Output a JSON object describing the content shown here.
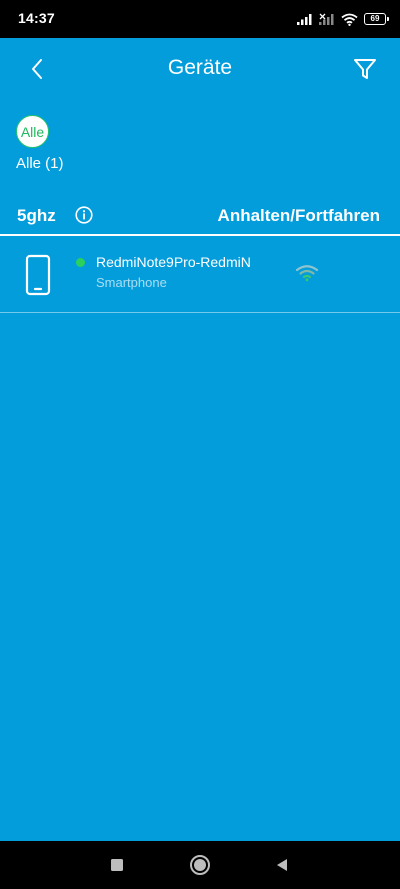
{
  "status_bar": {
    "time": "14:37",
    "battery": "69",
    "icons": [
      "signal-icon",
      "signal-no-service-icon",
      "wifi-icon",
      "battery-icon"
    ]
  },
  "header": {
    "title": "Geräte",
    "back_icon": "chevron-left-icon",
    "filter_icon": "filter-funnel-icon"
  },
  "filter": {
    "chip_label": "Alle",
    "count_label": "Alle (1)"
  },
  "band": {
    "label": "5ghz",
    "info_icon": "info-icon",
    "action_label": "Anhalten/Fortfahren"
  },
  "devices": [
    {
      "name": "RedmiNote9Pro-RedmiN",
      "type": "Smartphone",
      "icon": "smartphone-icon",
      "status_color": "#2bd15a",
      "signal_icon": "wifi-signal-icon"
    }
  ],
  "nav": {
    "icons": [
      "recents-square-icon",
      "home-circle-icon",
      "back-triangle-icon"
    ]
  },
  "colors": {
    "background": "#049ddb",
    "accent_green": "#27c46b"
  }
}
